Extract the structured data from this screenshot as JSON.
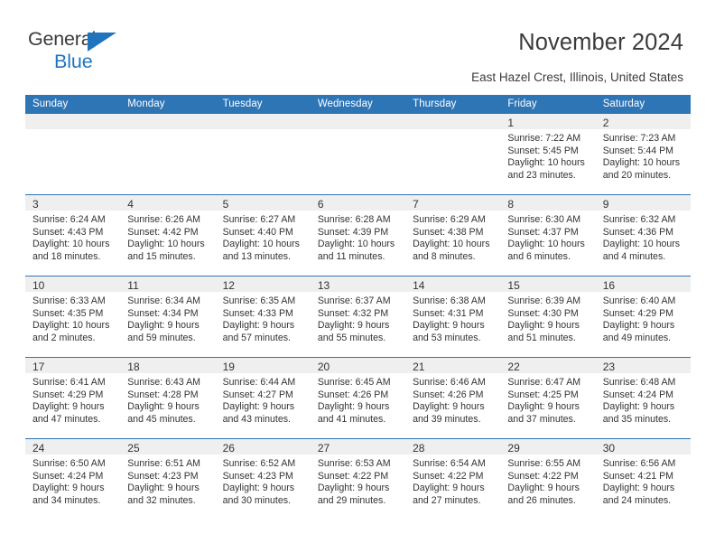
{
  "brand": {
    "name_part1": "General",
    "name_part2": "Blue",
    "accent_color": "#1f74bd"
  },
  "header": {
    "title": "November 2024",
    "subtitle": "East Hazel Crest, Illinois, United States"
  },
  "theme": {
    "header_blue": "#2e75b6",
    "band_gray": "#efefef",
    "text": "#333333"
  },
  "weekday_headers": [
    "Sunday",
    "Monday",
    "Tuesday",
    "Wednesday",
    "Thursday",
    "Friday",
    "Saturday"
  ],
  "labels": {
    "sunrise": "Sunrise:",
    "sunset": "Sunset:",
    "daylight": "Daylight:"
  },
  "weeks": [
    [
      {
        "empty": true,
        "day": "",
        "sunrise": "",
        "sunset": "",
        "daylight_1": "",
        "daylight_2": ""
      },
      {
        "empty": true,
        "day": "",
        "sunrise": "",
        "sunset": "",
        "daylight_1": "",
        "daylight_2": ""
      },
      {
        "empty": true,
        "day": "",
        "sunrise": "",
        "sunset": "",
        "daylight_1": "",
        "daylight_2": ""
      },
      {
        "empty": true,
        "day": "",
        "sunrise": "",
        "sunset": "",
        "daylight_1": "",
        "daylight_2": ""
      },
      {
        "empty": true,
        "day": "",
        "sunrise": "",
        "sunset": "",
        "daylight_1": "",
        "daylight_2": ""
      },
      {
        "empty": false,
        "day": "1",
        "sunrise": "Sunrise: 7:22 AM",
        "sunset": "Sunset: 5:45 PM",
        "daylight_1": "Daylight: 10 hours",
        "daylight_2": "and 23 minutes."
      },
      {
        "empty": false,
        "day": "2",
        "sunrise": "Sunrise: 7:23 AM",
        "sunset": "Sunset: 5:44 PM",
        "daylight_1": "Daylight: 10 hours",
        "daylight_2": "and 20 minutes."
      }
    ],
    [
      {
        "empty": false,
        "day": "3",
        "sunrise": "Sunrise: 6:24 AM",
        "sunset": "Sunset: 4:43 PM",
        "daylight_1": "Daylight: 10 hours",
        "daylight_2": "and 18 minutes."
      },
      {
        "empty": false,
        "day": "4",
        "sunrise": "Sunrise: 6:26 AM",
        "sunset": "Sunset: 4:42 PM",
        "daylight_1": "Daylight: 10 hours",
        "daylight_2": "and 15 minutes."
      },
      {
        "empty": false,
        "day": "5",
        "sunrise": "Sunrise: 6:27 AM",
        "sunset": "Sunset: 4:40 PM",
        "daylight_1": "Daylight: 10 hours",
        "daylight_2": "and 13 minutes."
      },
      {
        "empty": false,
        "day": "6",
        "sunrise": "Sunrise: 6:28 AM",
        "sunset": "Sunset: 4:39 PM",
        "daylight_1": "Daylight: 10 hours",
        "daylight_2": "and 11 minutes."
      },
      {
        "empty": false,
        "day": "7",
        "sunrise": "Sunrise: 6:29 AM",
        "sunset": "Sunset: 4:38 PM",
        "daylight_1": "Daylight: 10 hours",
        "daylight_2": "and 8 minutes."
      },
      {
        "empty": false,
        "day": "8",
        "sunrise": "Sunrise: 6:30 AM",
        "sunset": "Sunset: 4:37 PM",
        "daylight_1": "Daylight: 10 hours",
        "daylight_2": "and 6 minutes."
      },
      {
        "empty": false,
        "day": "9",
        "sunrise": "Sunrise: 6:32 AM",
        "sunset": "Sunset: 4:36 PM",
        "daylight_1": "Daylight: 10 hours",
        "daylight_2": "and 4 minutes."
      }
    ],
    [
      {
        "empty": false,
        "day": "10",
        "sunrise": "Sunrise: 6:33 AM",
        "sunset": "Sunset: 4:35 PM",
        "daylight_1": "Daylight: 10 hours",
        "daylight_2": "and 2 minutes."
      },
      {
        "empty": false,
        "day": "11",
        "sunrise": "Sunrise: 6:34 AM",
        "sunset": "Sunset: 4:34 PM",
        "daylight_1": "Daylight: 9 hours",
        "daylight_2": "and 59 minutes."
      },
      {
        "empty": false,
        "day": "12",
        "sunrise": "Sunrise: 6:35 AM",
        "sunset": "Sunset: 4:33 PM",
        "daylight_1": "Daylight: 9 hours",
        "daylight_2": "and 57 minutes."
      },
      {
        "empty": false,
        "day": "13",
        "sunrise": "Sunrise: 6:37 AM",
        "sunset": "Sunset: 4:32 PM",
        "daylight_1": "Daylight: 9 hours",
        "daylight_2": "and 55 minutes."
      },
      {
        "empty": false,
        "day": "14",
        "sunrise": "Sunrise: 6:38 AM",
        "sunset": "Sunset: 4:31 PM",
        "daylight_1": "Daylight: 9 hours",
        "daylight_2": "and 53 minutes."
      },
      {
        "empty": false,
        "day": "15",
        "sunrise": "Sunrise: 6:39 AM",
        "sunset": "Sunset: 4:30 PM",
        "daylight_1": "Daylight: 9 hours",
        "daylight_2": "and 51 minutes."
      },
      {
        "empty": false,
        "day": "16",
        "sunrise": "Sunrise: 6:40 AM",
        "sunset": "Sunset: 4:29 PM",
        "daylight_1": "Daylight: 9 hours",
        "daylight_2": "and 49 minutes."
      }
    ],
    [
      {
        "empty": false,
        "day": "17",
        "sunrise": "Sunrise: 6:41 AM",
        "sunset": "Sunset: 4:29 PM",
        "daylight_1": "Daylight: 9 hours",
        "daylight_2": "and 47 minutes."
      },
      {
        "empty": false,
        "day": "18",
        "sunrise": "Sunrise: 6:43 AM",
        "sunset": "Sunset: 4:28 PM",
        "daylight_1": "Daylight: 9 hours",
        "daylight_2": "and 45 minutes."
      },
      {
        "empty": false,
        "day": "19",
        "sunrise": "Sunrise: 6:44 AM",
        "sunset": "Sunset: 4:27 PM",
        "daylight_1": "Daylight: 9 hours",
        "daylight_2": "and 43 minutes."
      },
      {
        "empty": false,
        "day": "20",
        "sunrise": "Sunrise: 6:45 AM",
        "sunset": "Sunset: 4:26 PM",
        "daylight_1": "Daylight: 9 hours",
        "daylight_2": "and 41 minutes."
      },
      {
        "empty": false,
        "day": "21",
        "sunrise": "Sunrise: 6:46 AM",
        "sunset": "Sunset: 4:26 PM",
        "daylight_1": "Daylight: 9 hours",
        "daylight_2": "and 39 minutes."
      },
      {
        "empty": false,
        "day": "22",
        "sunrise": "Sunrise: 6:47 AM",
        "sunset": "Sunset: 4:25 PM",
        "daylight_1": "Daylight: 9 hours",
        "daylight_2": "and 37 minutes."
      },
      {
        "empty": false,
        "day": "23",
        "sunrise": "Sunrise: 6:48 AM",
        "sunset": "Sunset: 4:24 PM",
        "daylight_1": "Daylight: 9 hours",
        "daylight_2": "and 35 minutes."
      }
    ],
    [
      {
        "empty": false,
        "day": "24",
        "sunrise": "Sunrise: 6:50 AM",
        "sunset": "Sunset: 4:24 PM",
        "daylight_1": "Daylight: 9 hours",
        "daylight_2": "and 34 minutes."
      },
      {
        "empty": false,
        "day": "25",
        "sunrise": "Sunrise: 6:51 AM",
        "sunset": "Sunset: 4:23 PM",
        "daylight_1": "Daylight: 9 hours",
        "daylight_2": "and 32 minutes."
      },
      {
        "empty": false,
        "day": "26",
        "sunrise": "Sunrise: 6:52 AM",
        "sunset": "Sunset: 4:23 PM",
        "daylight_1": "Daylight: 9 hours",
        "daylight_2": "and 30 minutes."
      },
      {
        "empty": false,
        "day": "27",
        "sunrise": "Sunrise: 6:53 AM",
        "sunset": "Sunset: 4:22 PM",
        "daylight_1": "Daylight: 9 hours",
        "daylight_2": "and 29 minutes."
      },
      {
        "empty": false,
        "day": "28",
        "sunrise": "Sunrise: 6:54 AM",
        "sunset": "Sunset: 4:22 PM",
        "daylight_1": "Daylight: 9 hours",
        "daylight_2": "and 27 minutes."
      },
      {
        "empty": false,
        "day": "29",
        "sunrise": "Sunrise: 6:55 AM",
        "sunset": "Sunset: 4:22 PM",
        "daylight_1": "Daylight: 9 hours",
        "daylight_2": "and 26 minutes."
      },
      {
        "empty": false,
        "day": "30",
        "sunrise": "Sunrise: 6:56 AM",
        "sunset": "Sunset: 4:21 PM",
        "daylight_1": "Daylight: 9 hours",
        "daylight_2": "and 24 minutes."
      }
    ]
  ]
}
